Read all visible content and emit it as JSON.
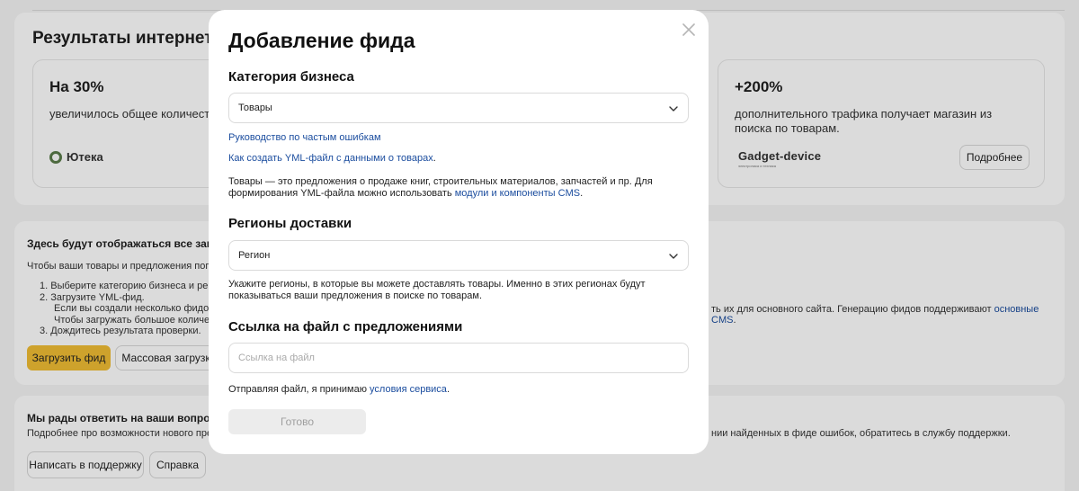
{
  "results": {
    "title": "Результаты интернет-ма",
    "card_left": {
      "value": "На 30%",
      "description": "увеличилось общее количество з",
      "brand": "Ютека"
    },
    "card_right": {
      "value": "+200%",
      "description": "дополнительного трафика получает магазин из поиска по товарам.",
      "brand": "Gadget-device",
      "brand_sub": "электроника и техника",
      "button": "Подробнее"
    }
  },
  "feeds": {
    "title": "Здесь будут отображаться все загру",
    "intro": "Чтобы ваши товары и предложения попали",
    "step1": "1. Выберите категорию бизнеса и регис",
    "step2": "2. Загрузите YML-фид.",
    "step2_sub1": "Если вы создали несколько фидов, на",
    "step2_sub2": "Чтобы загружать большое количеств",
    "step3": "3. Дождитесь результата проверки.",
    "right_text": "ть их для основного сайта. Генерацию фидов поддерживают ",
    "right_link": "основные CMS",
    "right_end": ".",
    "upload_button": "Загрузить фид",
    "bulk_button": "Массовая загрузка"
  },
  "help": {
    "title": "Мы рады ответить на ваши вопрос",
    "text": "Подробнее про возможности нового предста",
    "right_text": "нии найденных в фиде ошибок, обратитесь в службу поддержки.",
    "support_button": "Написать в поддержку",
    "reference_button": "Справка"
  },
  "modal": {
    "title": "Добавление фида",
    "category": {
      "title": "Категория бизнеса",
      "selected": "Товары",
      "link_errors": "Руководство по частым ошибкам",
      "link_yml": "Как создать YML-файл с данными о товарах",
      "link_yml_end": ".",
      "info": "Товары — это предложения о продаже книг, строительных материалов, запчастей и пр. Для формирования YML-файла можно использовать ",
      "info_link": "модули и компоненты CMS",
      "info_end": "."
    },
    "regions": {
      "title": "Регионы доставки",
      "selected": "Регион",
      "info": "Укажите регионы, в которые вы можете доставлять товары. Именно в этих регионах будут показываться ваши предложения в поиске по товарам."
    },
    "file_link": {
      "title": "Ссылка на файл с предложениями",
      "placeholder": "Ссылка на файл",
      "agreement": "Отправляя файл, я принимаю ",
      "agreement_link": "условия сервиса",
      "agreement_end": "."
    },
    "done_button": "Готово"
  }
}
